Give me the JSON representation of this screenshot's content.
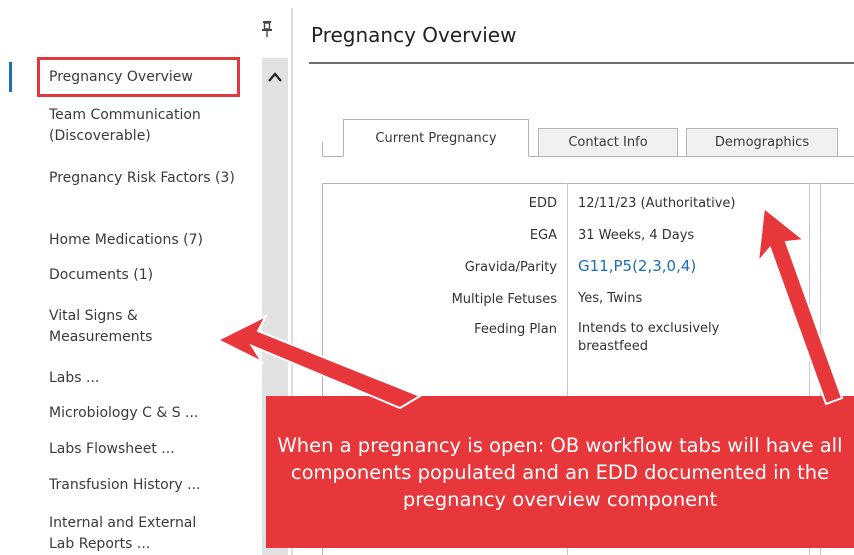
{
  "sidebar": {
    "items": [
      {
        "label": "Pregnancy Overview"
      },
      {
        "label": "Team Communication (Discoverable)"
      },
      {
        "label": "Pregnancy Risk Factors (3)"
      },
      {
        "label": "Home Medications (7)"
      },
      {
        "label": "Documents (1)"
      },
      {
        "label": "Vital Signs & Measurements"
      },
      {
        "label": "Labs ..."
      },
      {
        "label": "Microbiology C & S ..."
      },
      {
        "label": "Labs Flowsheet ..."
      },
      {
        "label": "Transfusion History ..."
      },
      {
        "label": "Internal and External Lab Reports ..."
      }
    ],
    "pin_icon": "pin-icon",
    "scroll_up_icon": "chevron-up-icon"
  },
  "main": {
    "title": "Pregnancy Overview",
    "tabs": [
      {
        "label": "Current Pregnancy",
        "active": true
      },
      {
        "label": "Contact Info",
        "active": false
      },
      {
        "label": "Demographics",
        "active": false
      }
    ],
    "fields": [
      {
        "label": "EDD",
        "value": "12/11/23 (Authoritative)"
      },
      {
        "label": "EGA",
        "value": "31 Weeks, 4 Days"
      },
      {
        "label": "Gravida/Parity",
        "value": "G11,P5(2,3,0,4)"
      },
      {
        "label": "Multiple Fetuses",
        "value": "Yes, Twins"
      },
      {
        "label": "Feeding Plan",
        "value": "Intends to exclusively breastfeed"
      }
    ]
  },
  "callout": {
    "text": "When a pregnancy is open: OB workflow tabs will have all components populated and an EDD documented in the pregnancy overview component"
  },
  "colors": {
    "callout": "#e8373b",
    "highlight_box": "#e0383c",
    "link": "#1a6fb5"
  }
}
